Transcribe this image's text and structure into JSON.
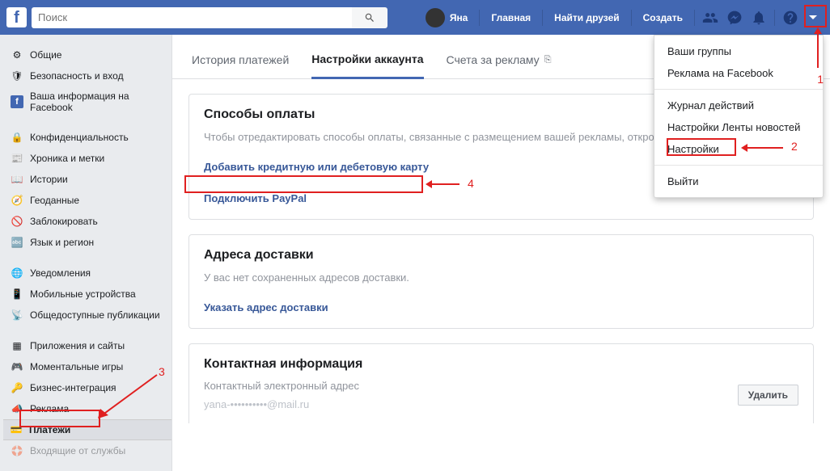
{
  "topbar": {
    "search_placeholder": "Поиск",
    "user_name": "Яна",
    "links": {
      "home": "Главная",
      "find_friends": "Найти друзей",
      "create": "Создать"
    }
  },
  "dropdown": {
    "groups": "Ваши группы",
    "ads": "Реклама на Facebook",
    "activity_log": "Журнал действий",
    "feed_prefs": "Настройки Ленты новостей",
    "settings": "Настройки",
    "logout": "Выйти"
  },
  "sidebar": {
    "general": "Общие",
    "security": "Безопасность и вход",
    "your_info": "Ваша информация на Facebook",
    "privacy": "Конфиденциальность",
    "timeline": "Хроника и метки",
    "stories": "Истории",
    "location": "Геоданные",
    "blocking": "Заблокировать",
    "language": "Язык и регион",
    "notifications": "Уведомления",
    "mobile": "Мобильные устройства",
    "public_posts": "Общедоступные публикации",
    "apps": "Приложения и сайты",
    "instant_games": "Моментальные игры",
    "biz_integration": "Бизнес-интеграция",
    "ads": "Реклама",
    "payments": "Платежи",
    "support_inbox": "Входящие от службы"
  },
  "tabs": {
    "history": "История платежей",
    "account": "Настройки аккаунта",
    "billing": "Счета за рекламу"
  },
  "sections": {
    "payment_methods": {
      "title": "Способы оплаты",
      "desc": "Чтобы отредактировать способы оплаты, связанные с размещением вашей рекламы, откройте \"Счета за рекламу\".",
      "add_card": "Добавить кредитную или дебетовую карту",
      "connect_paypal": "Подключить PayPal"
    },
    "shipping": {
      "title": "Адреса доставки",
      "desc": "У вас нет сохраненных адресов доставки.",
      "add_address": "Указать адрес доставки"
    },
    "contact": {
      "title": "Контактная информация",
      "label": "Контактный электронный адрес",
      "masked_email": "yana-••••••••••@mail.ru",
      "delete": "Удалить"
    }
  },
  "annotations": {
    "n1": "1",
    "n2": "2",
    "n3": "3",
    "n4": "4"
  }
}
